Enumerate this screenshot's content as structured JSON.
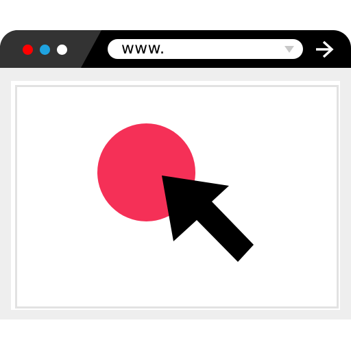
{
  "colors": {
    "titlebar": "#000000",
    "titlebar_accent": "#333333",
    "close_dot": "#ff0000",
    "minimize_dot": "#1fa3e0",
    "maximize_dot": "#ffffff",
    "content_background": "#eeeeee",
    "target": "#f53057",
    "cursor": "#000000"
  },
  "address_bar": {
    "text": "www."
  },
  "icons": {
    "go": "right-arrow-icon",
    "dropdown": "triangle-down-icon",
    "pointer": "mouse-pointer-icon"
  }
}
